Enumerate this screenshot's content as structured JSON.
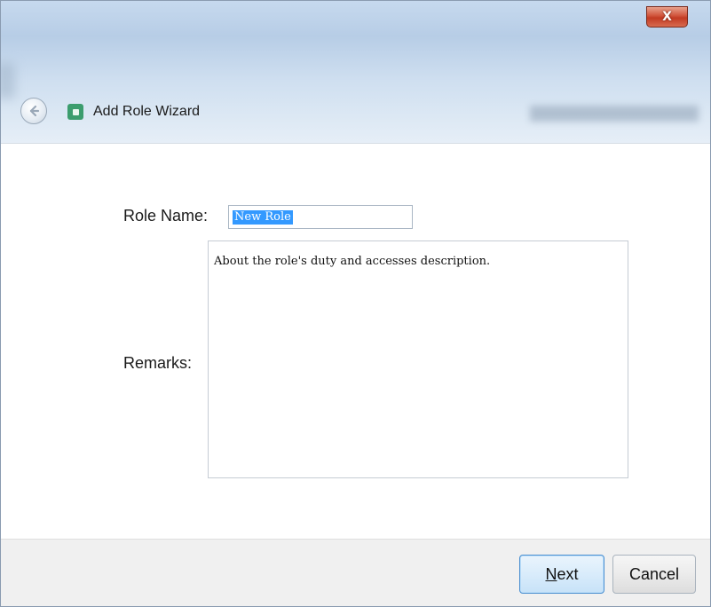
{
  "window": {
    "close_label": "X"
  },
  "header": {
    "back_icon": "back-arrow-icon",
    "app_icon": "app-icon",
    "title": "Add Role Wizard"
  },
  "form": {
    "role_name_label": "Role Name:",
    "role_name_value": "New Role",
    "remarks_label": "Remarks:",
    "remarks_value": "About the role's duty and accesses description."
  },
  "footer": {
    "next_mnemonic": "N",
    "next_rest": "ext",
    "cancel_label": "Cancel"
  },
  "colors": {
    "accent": "#3399ff",
    "close": "#c23a22",
    "app_icon": "#3c9d6e"
  }
}
